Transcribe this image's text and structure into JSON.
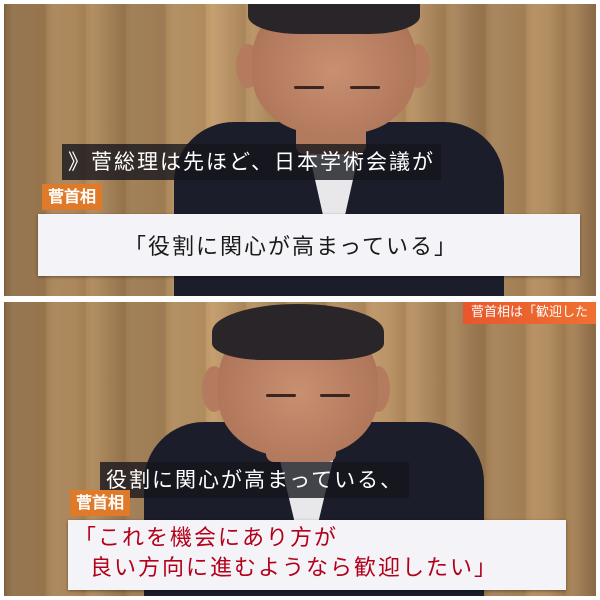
{
  "top_panel": {
    "lower_third": "》菅総理は先ほど、日本学術会議が",
    "speaker_tag": "菅首相",
    "quote_lines": [
      "「役割に関心が高まっている」"
    ]
  },
  "bottom_panel": {
    "corner_ticker": "菅首相は「歓迎した",
    "lower_third": "役割に関心が高まっている、",
    "speaker_tag": "菅首相",
    "quote_lines": [
      "「これを機会にあり方が",
      "良い方向に進むようなら歓迎したい」"
    ]
  },
  "colors": {
    "speaker_tag_bg": "#e07a2b",
    "quote_text_top": "#1a1a1a",
    "quote_text_bottom": "#b3001b",
    "ticker_bg": "#e8572c"
  }
}
